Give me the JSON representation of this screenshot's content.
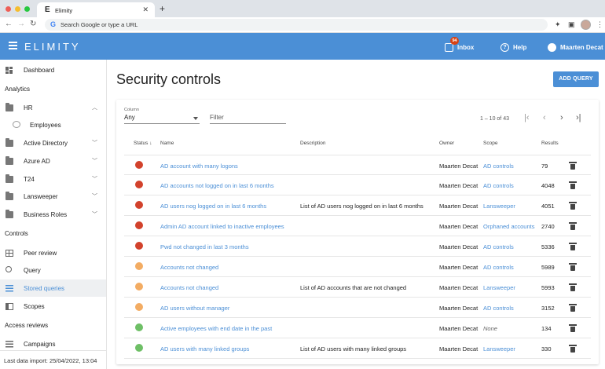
{
  "browser": {
    "tab_title": "Elimity",
    "tab_logo": "E",
    "address_text": "Search Google or type a URL",
    "traffic_colors": [
      "#ee5f57",
      "#f5bd2f",
      "#28c840"
    ]
  },
  "header": {
    "brand": "ELIMITY",
    "inbox_label": "Inbox",
    "inbox_badge": "94",
    "help_label": "Help",
    "user_label": "Maarten Decat",
    "color": "#4b8fd6"
  },
  "sidebar": {
    "dashboard": "Dashboard",
    "section_analytics": "Analytics",
    "hr": "HR",
    "employees": "Employees",
    "active_directory": "Active Directory",
    "azure_ad": "Azure AD",
    "t24": "T24",
    "lansweeper": "Lansweeper",
    "business_roles": "Business Roles",
    "section_controls": "Controls",
    "peer_review": "Peer review",
    "query": "Query",
    "stored_queries": "Stored queries",
    "scopes": "Scopes",
    "section_access_reviews": "Access reviews",
    "campaigns": "Campaigns",
    "last_import": "Last data import: 25/04/2022, 13:04"
  },
  "main": {
    "title": "Security controls",
    "add_query": "ADD QUERY",
    "column_label": "Column",
    "column_value": "Any",
    "filter_placeholder": "Filter",
    "pager_text": "1 – 10 of 43",
    "headers": {
      "status": "Status",
      "name": "Name",
      "description": "Description",
      "owner": "Owner",
      "scope": "Scope",
      "results": "Results"
    }
  },
  "status_colors": {
    "red": "#d2422c",
    "orange": "#f3ac63",
    "green": "#6ebf66"
  },
  "rows": [
    {
      "status": "red",
      "name": "AD account with many logons",
      "description": "",
      "owner": "Maarten Decat",
      "scope": "AD controls",
      "results": "79"
    },
    {
      "status": "red",
      "name": "AD accounts not logged on in last 6 months",
      "description": "",
      "owner": "Maarten Decat",
      "scope": "AD controls",
      "results": "4048"
    },
    {
      "status": "red",
      "name": "AD users nog logged on in last 6 months",
      "description": "List of AD users nog logged on in last 6 months",
      "owner": "Maarten Decat",
      "scope": "Lansweeper",
      "results": "4051"
    },
    {
      "status": "red",
      "name": "Admin AD account linked to inactive employees",
      "description": "",
      "owner": "Maarten Decat",
      "scope": "Orphaned accounts",
      "results": "2740"
    },
    {
      "status": "red",
      "name": "Pwd not changed in last 3 months",
      "description": "",
      "owner": "Maarten Decat",
      "scope": "AD controls",
      "results": "5336"
    },
    {
      "status": "orange",
      "name": "Accounts not changed",
      "description": "",
      "owner": "Maarten Decat",
      "scope": "AD controls",
      "results": "5989"
    },
    {
      "status": "orange",
      "name": "Accounts not changed",
      "description": "List of AD accounts that are not changed",
      "owner": "Maarten Decat",
      "scope": "Lansweeper",
      "results": "5993"
    },
    {
      "status": "orange",
      "name": "AD users without manager",
      "description": "",
      "owner": "Maarten Decat",
      "scope": "AD controls",
      "results": "3152"
    },
    {
      "status": "green",
      "name": "Active employees with end date in the past",
      "description": "",
      "owner": "Maarten Decat",
      "scope": "None",
      "results": "134"
    },
    {
      "status": "green",
      "name": "AD users with many linked groups",
      "description": "List of AD users with many linked groups",
      "owner": "Maarten Decat",
      "scope": "Lansweeper",
      "results": "330"
    }
  ]
}
